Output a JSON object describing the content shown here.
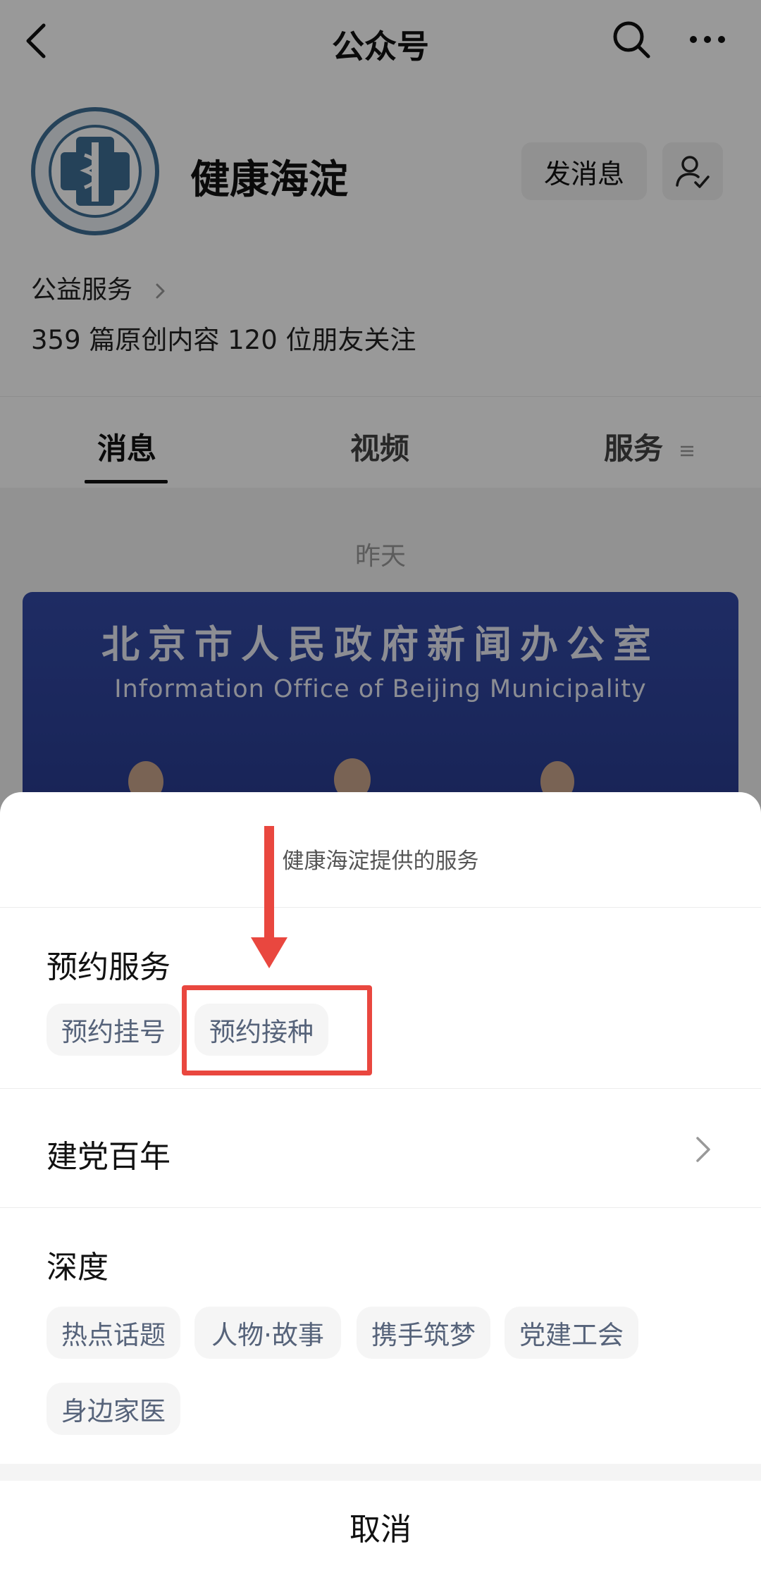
{
  "topbar": {
    "title": "公众号",
    "back_icon": "chevron-left-icon",
    "search_icon": "search-icon",
    "more_icon": "more-icon"
  },
  "profile": {
    "name": "健康海淀",
    "message_button": "发消息",
    "category": "公益服务",
    "stats": "359 篇原创内容  120 位朋友关注"
  },
  "tabs": [
    {
      "label": "消息",
      "active": true
    },
    {
      "label": "视频",
      "active": false
    },
    {
      "label": "服务",
      "active": false
    }
  ],
  "feed": {
    "date_label": "昨天",
    "banner_title_cn": "北京市人民政府新闻办公室",
    "banner_title_en": "Information Office of Beijing Municipality"
  },
  "sheet": {
    "title": "健康海淀提供的服务",
    "sections": [
      {
        "title": "预约服务",
        "chips": [
          "预约挂号",
          "预约接种"
        ]
      },
      {
        "title": "建党百年",
        "chips": []
      },
      {
        "title": "深度",
        "chips": [
          "热点话题",
          "人物·故事",
          "携手筑梦",
          "党建工会",
          "身边家医"
        ]
      }
    ],
    "cancel": "取消"
  },
  "colors": {
    "annotation_red": "#e9473f",
    "chip_text": "#56637a"
  }
}
